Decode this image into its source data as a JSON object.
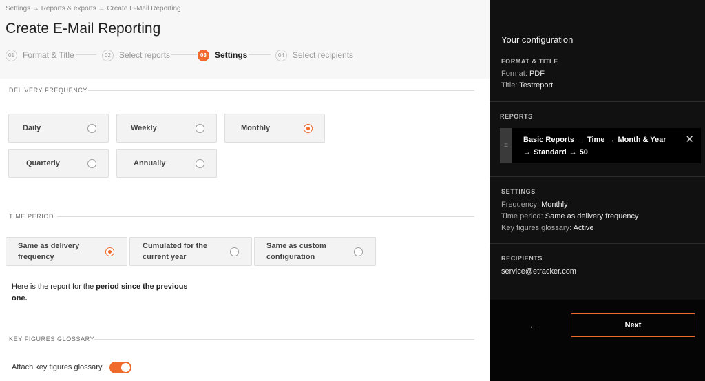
{
  "breadcrumb": [
    "Settings",
    "Reports & exports",
    "Create E-Mail Reporting"
  ],
  "breadcrumb_sep": "→",
  "page_title": "Create E-Mail Reporting",
  "steps": [
    {
      "num": "01",
      "label": "Format & Title",
      "state": "done"
    },
    {
      "num": "02",
      "label": "Select reports",
      "state": "done"
    },
    {
      "num": "03",
      "label": "Settings",
      "state": "active"
    },
    {
      "num": "04",
      "label": "Select recipients",
      "state": "pending"
    }
  ],
  "delivery_frequency": {
    "label": "Delivery frequency",
    "options": [
      "Daily",
      "Weekly",
      "Monthly",
      "Quarterly",
      "Annually"
    ],
    "selected": "Monthly"
  },
  "time_period": {
    "label": "Time period",
    "options": [
      "Same as delivery frequency",
      "Cumulated for the current year",
      "Same as custom configuration"
    ],
    "selected": "Same as delivery frequency",
    "desc_prefix": "Here is the report for the ",
    "desc_bold": "period since the previous one."
  },
  "glossary": {
    "label": "Key figures glossary",
    "toggle_label": "Attach key figures glossary",
    "enabled": true
  },
  "panel": {
    "title": "Your configuration",
    "format_title": {
      "label": "Format & Title",
      "format_key": "Format:",
      "format_value": "PDF",
      "title_key": "Title:",
      "title_value": "Testreport"
    },
    "reports": {
      "label": "Reports",
      "path": [
        "Basic Reports",
        "Time",
        "Month & Year",
        "Standard",
        "50"
      ],
      "arrow": "→",
      "handle_icon": "≡",
      "close_icon": "✕"
    },
    "settings": {
      "label": "Settings",
      "frequency_key": "Frequency:",
      "frequency_value": "Monthly",
      "period_key": "Time period:",
      "period_value": "Same as delivery frequency",
      "glossary_key": "Key figures glossary:",
      "glossary_value": "Active"
    },
    "recipients": {
      "label": "Recipients",
      "email": "service@etracker.com"
    },
    "back_icon": "←",
    "next_label": "Next"
  },
  "colors": {
    "accent": "#f06a2c",
    "panel_bg": "#111111",
    "header_bg": "#f7f7f7"
  }
}
